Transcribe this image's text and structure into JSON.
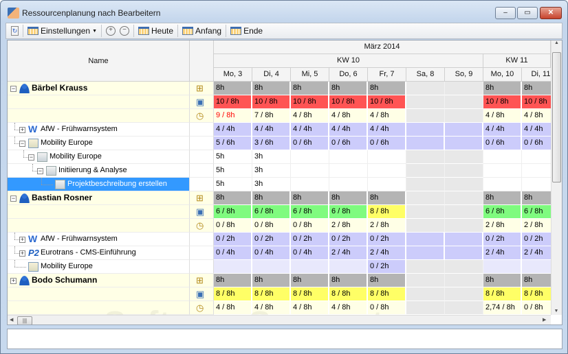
{
  "window": {
    "title": "Ressourcenplanung nach Bearbeitern",
    "min": "‒",
    "max": "▭",
    "close": "✕"
  },
  "toolbar": {
    "settings": "Einstellungen",
    "today": "Heute",
    "start": "Anfang",
    "end": "Ende",
    "zoom_in": "+",
    "zoom_out": "−"
  },
  "header": {
    "name": "Name",
    "month": "März 2014",
    "weeks": [
      "KW 10",
      "KW 11"
    ],
    "days": [
      "Mo, 3",
      "Di, 4",
      "Mi, 5",
      "Do, 6",
      "Fr, 7",
      "Sa, 8",
      "So, 9",
      "Mo, 10",
      "Di, 11"
    ]
  },
  "rows": [
    {
      "label": "Bärbel Krauss",
      "type": "person",
      "level": 0,
      "toggle": "−",
      "icon": "hierarchy-icon",
      "cells": [
        [
          "8h",
          "cap"
        ],
        [
          "8h",
          "cap"
        ],
        [
          "8h",
          "cap"
        ],
        [
          "8h",
          "cap"
        ],
        [
          "8h",
          "cap"
        ],
        [
          "",
          "we"
        ],
        [
          "",
          "we"
        ],
        [
          "8h",
          "cap"
        ],
        [
          "8h",
          "cap"
        ]
      ]
    },
    {
      "label": "",
      "type": "sub",
      "icon": "assignment-icon",
      "cells": [
        [
          "10 / 8h",
          "over"
        ],
        [
          "10 / 8h",
          "over"
        ],
        [
          "10 / 8h",
          "over"
        ],
        [
          "10 / 8h",
          "over"
        ],
        [
          "10 / 8h",
          "over"
        ],
        [
          "",
          "we"
        ],
        [
          "",
          "we"
        ],
        [
          "10 / 8h",
          "over"
        ],
        [
          "10 / 8h",
          "over"
        ]
      ]
    },
    {
      "label": "",
      "type": "sub",
      "icon": "clock-sum-icon",
      "cells": [
        [
          "9 / 8h",
          "sum",
          "#ff0000"
        ],
        [
          "7 / 8h",
          "sum"
        ],
        [
          "4 / 8h",
          "sum"
        ],
        [
          "4 / 8h",
          "sum"
        ],
        [
          "4 / 8h",
          "sum"
        ],
        [
          "",
          "we"
        ],
        [
          "",
          "we"
        ],
        [
          "4 / 8h",
          "sum"
        ],
        [
          "4 / 8h",
          "sum"
        ]
      ]
    },
    {
      "label": "AfW - Frühwarnsystem",
      "type": "afw",
      "level": 1,
      "toggle": "+",
      "cells": [
        [
          "4 / 4h",
          "proj"
        ],
        [
          "4 / 4h",
          "proj"
        ],
        [
          "4 / 4h",
          "proj"
        ],
        [
          "4 / 4h",
          "proj"
        ],
        [
          "4 / 4h",
          "proj"
        ],
        [
          "",
          "proj"
        ],
        [
          "",
          "proj"
        ],
        [
          "4 / 4h",
          "proj"
        ],
        [
          "4 / 4h",
          "proj"
        ]
      ]
    },
    {
      "label": "Mobility Europe",
      "type": "project",
      "level": 1,
      "toggle": "−",
      "cells": [
        [
          "5 / 6h",
          "proj"
        ],
        [
          "3 / 6h",
          "proj"
        ],
        [
          "0 / 6h",
          "proj"
        ],
        [
          "0 / 6h",
          "proj"
        ],
        [
          "0 / 6h",
          "proj"
        ],
        [
          "",
          "proj"
        ],
        [
          "",
          "proj"
        ],
        [
          "0 / 6h",
          "proj"
        ],
        [
          "0 / 6h",
          "proj"
        ]
      ]
    },
    {
      "label": "Mobility Europe",
      "type": "task",
      "level": 2,
      "toggle": "−",
      "cells": [
        [
          "5h",
          "plain"
        ],
        [
          "3h",
          "plain"
        ],
        [
          "",
          "plain"
        ],
        [
          "",
          "plain"
        ],
        [
          "",
          "plain"
        ],
        [
          "",
          "we"
        ],
        [
          "",
          "we"
        ],
        [
          "",
          "plain"
        ],
        [
          "",
          "plain"
        ]
      ]
    },
    {
      "label": "Initiierung & Analyse",
      "type": "task",
      "level": 3,
      "toggle": "−",
      "cells": [
        [
          "5h",
          "plain"
        ],
        [
          "3h",
          "plain"
        ],
        [
          "",
          "plain"
        ],
        [
          "",
          "plain"
        ],
        [
          "",
          "plain"
        ],
        [
          "",
          "we"
        ],
        [
          "",
          "we"
        ],
        [
          "",
          "plain"
        ],
        [
          "",
          "plain"
        ]
      ]
    },
    {
      "label": "Projektbeschreibung erstellen",
      "type": "task",
      "level": 4,
      "selected": true,
      "cells": [
        [
          "5h",
          "plain"
        ],
        [
          "3h",
          "plain"
        ],
        [
          "",
          "plain"
        ],
        [
          "",
          "plain"
        ],
        [
          "",
          "plain"
        ],
        [
          "",
          "we"
        ],
        [
          "",
          "we"
        ],
        [
          "",
          "plain"
        ],
        [
          "",
          "plain"
        ]
      ]
    },
    {
      "label": "Bastian Rosner",
      "type": "person",
      "level": 0,
      "toggle": "−",
      "icon": "hierarchy-icon",
      "cells": [
        [
          "8h",
          "cap"
        ],
        [
          "8h",
          "cap"
        ],
        [
          "8h",
          "cap"
        ],
        [
          "8h",
          "cap"
        ],
        [
          "8h",
          "cap"
        ],
        [
          "",
          "we"
        ],
        [
          "",
          "we"
        ],
        [
          "8h",
          "cap"
        ],
        [
          "8h",
          "cap"
        ]
      ]
    },
    {
      "label": "",
      "type": "sub",
      "icon": "assignment-icon",
      "cells": [
        [
          "6 / 8h",
          "ok"
        ],
        [
          "6 / 8h",
          "ok"
        ],
        [
          "6 / 8h",
          "ok"
        ],
        [
          "6 / 8h",
          "ok"
        ],
        [
          "8 / 8h",
          "full"
        ],
        [
          "",
          "we"
        ],
        [
          "",
          "we"
        ],
        [
          "6 / 8h",
          "ok"
        ],
        [
          "6 / 8h",
          "ok"
        ]
      ]
    },
    {
      "label": "",
      "type": "sub",
      "icon": "clock-sum-icon",
      "cells": [
        [
          "0 / 8h",
          "sum"
        ],
        [
          "0 / 8h",
          "sum"
        ],
        [
          "0 / 8h",
          "sum"
        ],
        [
          "2 / 8h",
          "sum"
        ],
        [
          "2 / 8h",
          "sum"
        ],
        [
          "",
          "we"
        ],
        [
          "",
          "we"
        ],
        [
          "2 / 8h",
          "sum"
        ],
        [
          "2 / 8h",
          "sum"
        ]
      ]
    },
    {
      "label": "AfW - Frühwarnsystem",
      "type": "afw",
      "level": 1,
      "toggle": "+",
      "cells": [
        [
          "0 / 2h",
          "proj"
        ],
        [
          "0 / 2h",
          "proj"
        ],
        [
          "0 / 2h",
          "proj"
        ],
        [
          "0 / 2h",
          "proj"
        ],
        [
          "0 / 2h",
          "proj"
        ],
        [
          "",
          "proj"
        ],
        [
          "",
          "proj"
        ],
        [
          "0 / 2h",
          "proj"
        ],
        [
          "0 / 2h",
          "proj"
        ]
      ]
    },
    {
      "label": "Eurotrans - CMS-Einführung",
      "type": "p2",
      "level": 1,
      "toggle": "+",
      "cells": [
        [
          "0 / 4h",
          "proj"
        ],
        [
          "0 / 4h",
          "proj"
        ],
        [
          "0 / 4h",
          "proj"
        ],
        [
          "2 / 4h",
          "proj"
        ],
        [
          "2 / 4h",
          "proj"
        ],
        [
          "",
          "proj"
        ],
        [
          "",
          "proj"
        ],
        [
          "2 / 4h",
          "proj"
        ],
        [
          "2 / 4h",
          "proj"
        ]
      ]
    },
    {
      "label": "Mobility Europe",
      "type": "project",
      "level": 1,
      "cells": [
        [
          "",
          "lav"
        ],
        [
          "",
          "lav"
        ],
        [
          "",
          "lav"
        ],
        [
          "",
          "lav"
        ],
        [
          "0 / 2h",
          "proj"
        ],
        [
          "",
          "we"
        ],
        [
          "",
          "we"
        ],
        [
          "",
          "lav"
        ],
        [
          "",
          "lav"
        ]
      ]
    },
    {
      "label": "Bodo Schumann",
      "type": "person",
      "level": 0,
      "toggle": "+",
      "icon": "hierarchy-icon",
      "cells": [
        [
          "8h",
          "cap"
        ],
        [
          "8h",
          "cap"
        ],
        [
          "8h",
          "cap"
        ],
        [
          "8h",
          "cap"
        ],
        [
          "8h",
          "cap"
        ],
        [
          "",
          "we"
        ],
        [
          "",
          "we"
        ],
        [
          "8h",
          "cap"
        ],
        [
          "8h",
          "cap"
        ]
      ]
    },
    {
      "label": "",
      "type": "sub",
      "icon": "assignment-icon",
      "cells": [
        [
          "8 / 8h",
          "full"
        ],
        [
          "8 / 8h",
          "full"
        ],
        [
          "8 / 8h",
          "full"
        ],
        [
          "8 / 8h",
          "full"
        ],
        [
          "8 / 8h",
          "full"
        ],
        [
          "",
          "we"
        ],
        [
          "",
          "we"
        ],
        [
          "8 / 8h",
          "full"
        ],
        [
          "8 / 8h",
          "full"
        ]
      ]
    },
    {
      "label": "",
      "type": "sub",
      "icon": "clock-sum-icon",
      "cells": [
        [
          "4 / 8h",
          "sum"
        ],
        [
          "4 / 8h",
          "sum"
        ],
        [
          "4 / 8h",
          "sum"
        ],
        [
          "4 / 8h",
          "sum"
        ],
        [
          "0 / 8h",
          "sum"
        ],
        [
          "",
          "we"
        ],
        [
          "",
          "we"
        ],
        [
          "2,74 / 8h",
          "sum"
        ],
        [
          "0 / 8h",
          "sum"
        ]
      ]
    }
  ],
  "watermark": {
    "main": "SoftwareSuggest",
    "suffix": ".com"
  }
}
